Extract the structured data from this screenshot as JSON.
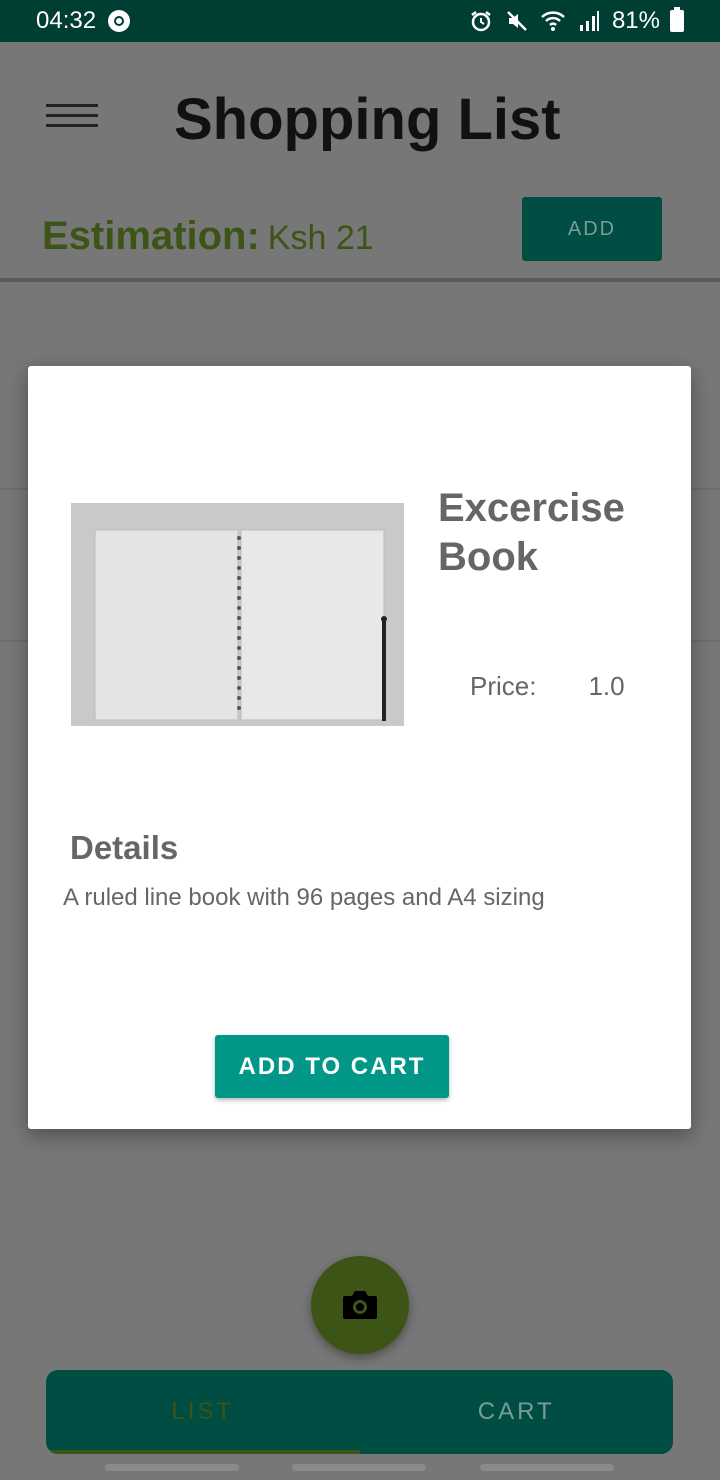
{
  "status_bar": {
    "time": "04:32",
    "battery": "81%",
    "icons": [
      "sync-icon",
      "alarm-icon",
      "mute-icon",
      "wifi-icon",
      "signal-icon",
      "battery-icon"
    ]
  },
  "header": {
    "title": "Shopping List",
    "menu_icon": "hamburger-menu-icon"
  },
  "estimation": {
    "label": "Estimation:",
    "value": "Ksh 21"
  },
  "toolbar": {
    "add_label": "ADD"
  },
  "dialog": {
    "product_name": "Excercise Book",
    "price_label": "Price:",
    "price_value": "1.0",
    "details_heading": "Details",
    "details_text": "A ruled line book with 96 pages and A4 sizing",
    "add_to_cart_label": "ADD TO CART",
    "image_description": "open spiral notebook with pencil"
  },
  "fab": {
    "icon": "camera-icon"
  },
  "bottom_nav": {
    "tabs": [
      {
        "label": "LIST",
        "selected": true
      },
      {
        "label": "CART",
        "selected": false
      }
    ]
  },
  "colors": {
    "status_bar": "#003d33",
    "primary": "#004d44",
    "accent": "#009688",
    "estimation_green": "#3c5417",
    "fab": "#3d5417"
  }
}
